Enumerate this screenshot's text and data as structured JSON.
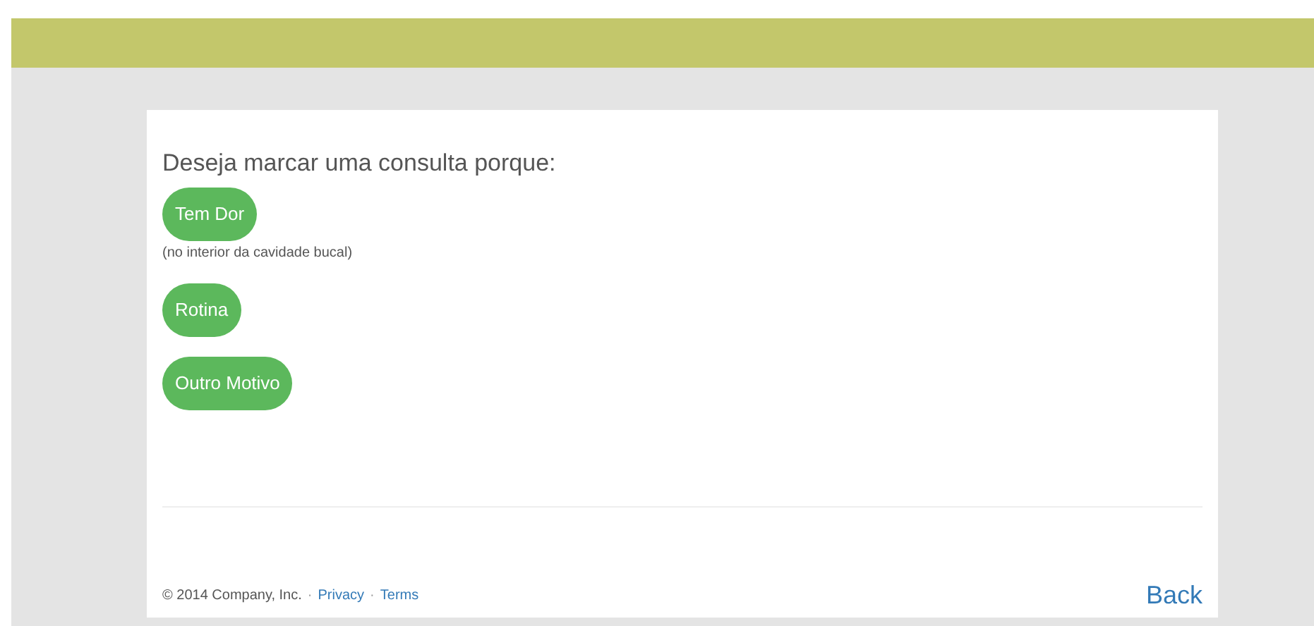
{
  "question": "Deseja marcar uma consulta porque:",
  "options": [
    {
      "label": "Tem Dor",
      "note": "(no interior da cavidade bucal)"
    },
    {
      "label": "Rotina"
    },
    {
      "label": "Outro Motivo"
    }
  ],
  "footer": {
    "items": [
      {
        "kind": "text",
        "text": "© 2014 Company, Inc."
      },
      {
        "kind": "separator",
        "text": "·"
      },
      {
        "kind": "link",
        "text": "Privacy"
      },
      {
        "kind": "separator",
        "text": "·"
      },
      {
        "kind": "link",
        "text": "Terms"
      }
    ],
    "back": "Back"
  }
}
